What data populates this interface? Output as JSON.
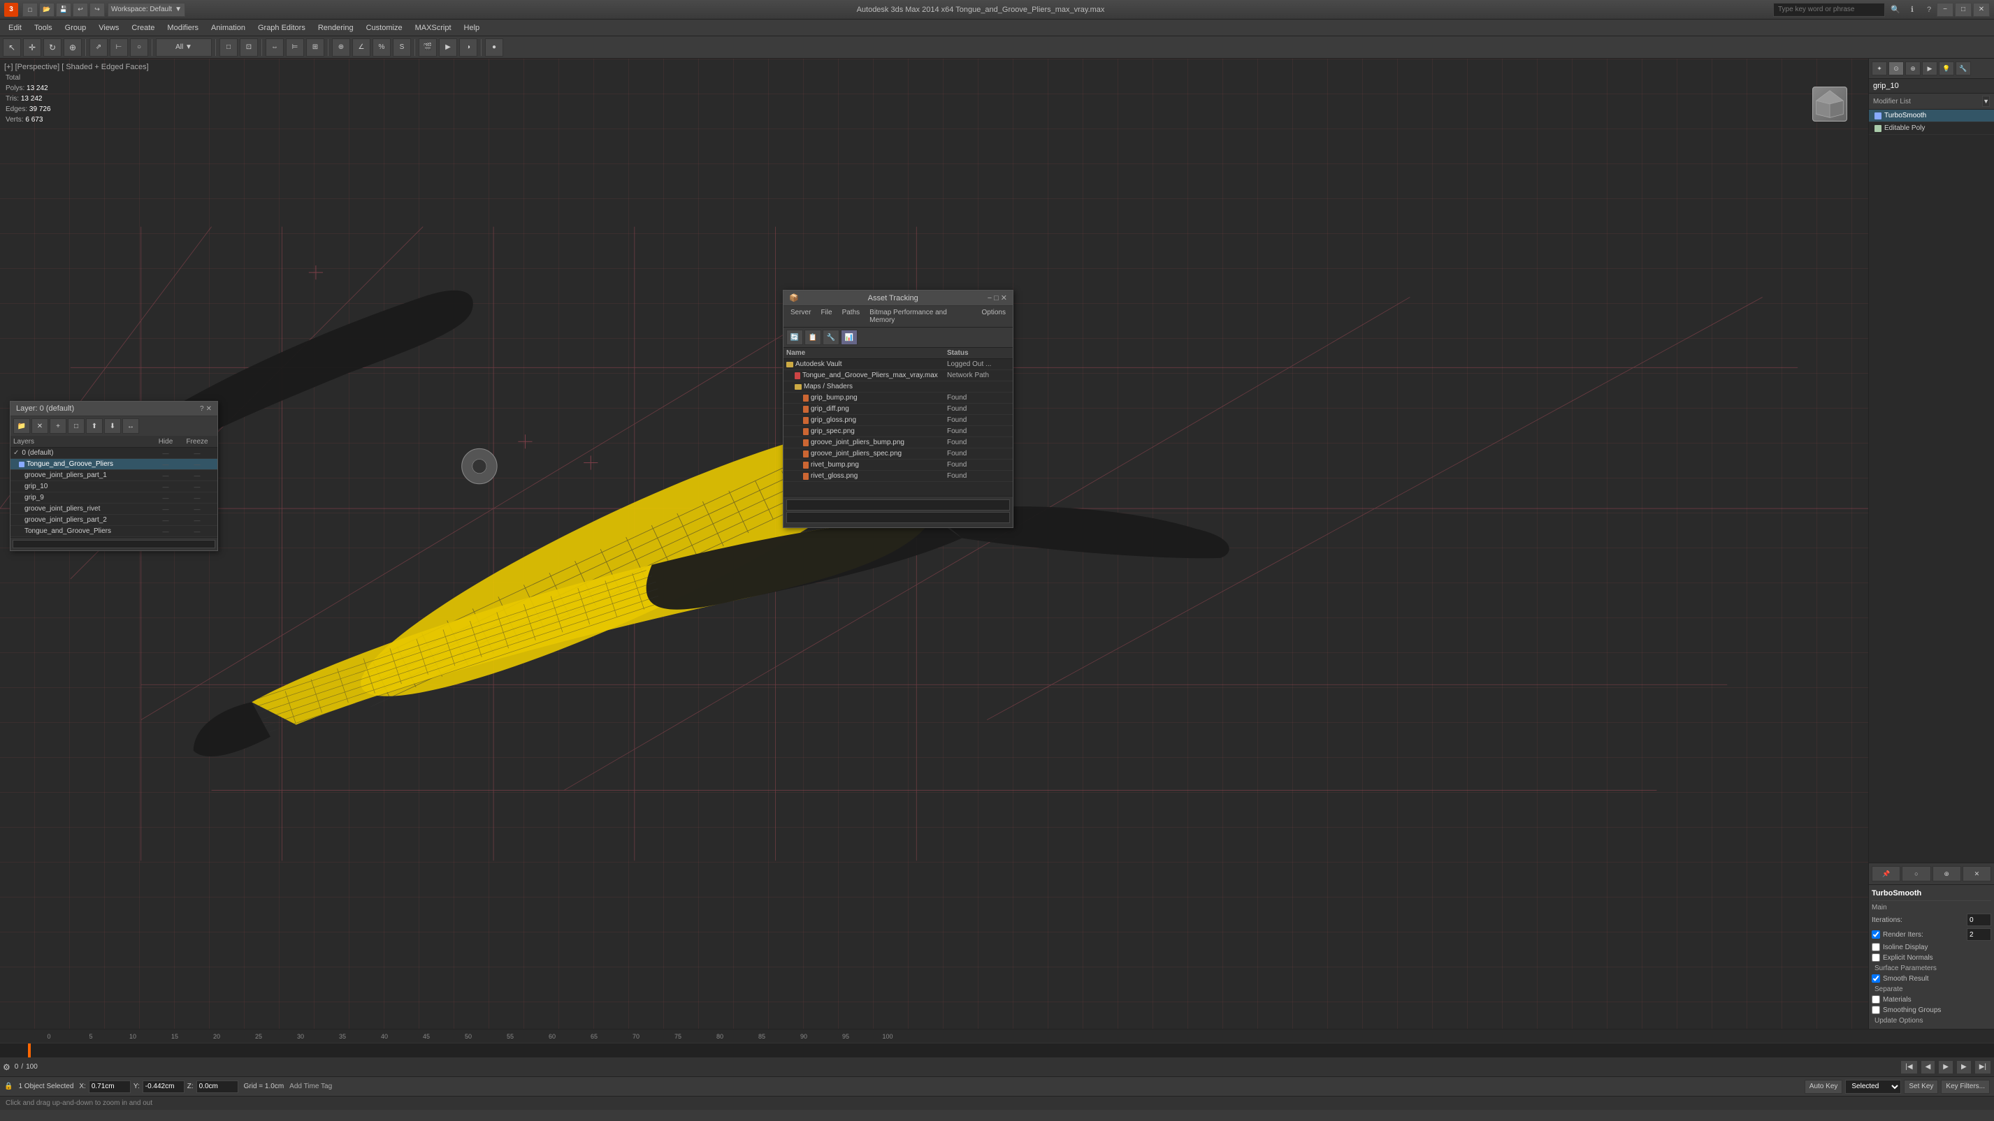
{
  "titlebar": {
    "app_icon": "3",
    "workspace_label": "Workspace: Default",
    "title": "Autodesk 3ds Max  2014 x64     Tongue_and_Groove_Pliers_max_vray.max",
    "search_placeholder": "Type key word or phrase",
    "min_label": "−",
    "max_label": "□",
    "close_label": "✕"
  },
  "menubar": {
    "items": [
      "Edit",
      "Tools",
      "Group",
      "Views",
      "Create",
      "Modifiers",
      "Animation",
      "Graph Editors",
      "Rendering",
      "Customize",
      "MAXScript",
      "Help"
    ]
  },
  "viewport": {
    "label": "[+] [Perspective] [ Shaded + Edged Faces]",
    "stats": {
      "total_label": "Total",
      "polys_label": "Polys:",
      "polys_value": "13 242",
      "tris_label": "Tris:",
      "tris_value": "13 242",
      "edges_label": "Edges:",
      "edges_value": "39 726",
      "verts_label": "Verts:",
      "verts_value": "6 673"
    }
  },
  "right_panel": {
    "object_name": "grip_10",
    "modifier_list_label": "Modifier List",
    "modifiers": [
      {
        "name": "TurboSmooth",
        "selected": true
      },
      {
        "name": "Editable Poly",
        "selected": false
      }
    ],
    "properties": {
      "title": "TurboSmooth",
      "main_label": "Main",
      "iterations_label": "Iterations:",
      "iterations_value": "0",
      "render_iters_label": "Render Iters:",
      "render_iters_value": "2",
      "isoline_display_label": "Isoline Display",
      "explicit_normals_label": "Explicit Normals",
      "surface_params_label": "Surface Parameters",
      "smooth_result_label": "Smooth Result",
      "smooth_result_checked": true,
      "separate_label": "Separate",
      "materials_label": "Materials",
      "smoothing_groups_label": "Smoothing Groups",
      "update_options_label": "Update Options"
    }
  },
  "layer_panel": {
    "title": "Layer: 0 (default)",
    "close_label": "✕",
    "toolbar_icons": [
      "📁",
      "✕",
      "+",
      "□",
      "⬆",
      "⬇",
      "↔"
    ],
    "header": {
      "layers_label": "Layers",
      "hide_label": "Hide",
      "freeze_label": "Freeze"
    },
    "layers": [
      {
        "name": "0 (default)",
        "indent": 0,
        "hide": "—",
        "freeze": "—",
        "has_check": true
      },
      {
        "name": "Tongue_and_Groove_Pliers",
        "indent": 1,
        "hide": "—",
        "freeze": "—",
        "selected": true
      },
      {
        "name": "groove_joint_pliers_part_1",
        "indent": 2,
        "hide": "—",
        "freeze": "—"
      },
      {
        "name": "grip_10",
        "indent": 2,
        "hide": "—",
        "freeze": "—"
      },
      {
        "name": "grip_9",
        "indent": 2,
        "hide": "—",
        "freeze": "—"
      },
      {
        "name": "groove_joint_pliers_rivet",
        "indent": 2,
        "hide": "—",
        "freeze": "—"
      },
      {
        "name": "groove_joint_pliers_part_2",
        "indent": 2,
        "hide": "—",
        "freeze": "—"
      },
      {
        "name": "Tongue_and_Groove_Pliers",
        "indent": 2,
        "hide": "—",
        "freeze": "—"
      }
    ]
  },
  "asset_panel": {
    "title": "Asset Tracking",
    "close_label": "✕",
    "min_label": "−",
    "max_label": "□",
    "menu_items": [
      "Server",
      "File",
      "Paths",
      "Bitmap Performance and Memory",
      "Options"
    ],
    "header": {
      "name_label": "Name",
      "status_label": "Status"
    },
    "assets": [
      {
        "name": "Autodesk Vault",
        "status": "Logged Out ...",
        "indent": 0,
        "type": "folder"
      },
      {
        "name": "Tongue_and_Groove_Pliers_max_vray.max",
        "status": "Network Path",
        "indent": 1,
        "type": "file"
      },
      {
        "name": "Maps / Shaders",
        "status": "",
        "indent": 1,
        "type": "folder"
      },
      {
        "name": "grip_bump.png",
        "status": "Found",
        "indent": 2,
        "type": "image"
      },
      {
        "name": "grip_diff.png",
        "status": "Found",
        "indent": 2,
        "type": "image"
      },
      {
        "name": "grip_gloss.png",
        "status": "Found",
        "indent": 2,
        "type": "image"
      },
      {
        "name": "grip_spec.png",
        "status": "Found",
        "indent": 2,
        "type": "image"
      },
      {
        "name": "groove_joint_pliers_bump.png",
        "status": "Found",
        "indent": 2,
        "type": "image"
      },
      {
        "name": "groove_joint_pliers_spec.png",
        "status": "Found",
        "indent": 2,
        "type": "image"
      },
      {
        "name": "rivet_bump.png",
        "status": "Found",
        "indent": 2,
        "type": "image"
      },
      {
        "name": "rivet_gloss.png",
        "status": "Found",
        "indent": 2,
        "type": "image"
      }
    ]
  },
  "timeline": {
    "frame_value": "0",
    "total_frames": "100",
    "ticks": [
      "0",
      "5",
      "10",
      "15",
      "20",
      "25",
      "30",
      "35",
      "40",
      "45",
      "50",
      "55",
      "60",
      "65",
      "70",
      "75",
      "80",
      "85",
      "90",
      "95",
      "100"
    ]
  },
  "status_bar": {
    "objects_selected": "1 Object Selected",
    "hint": "Click and drag up-and-down to zoom in and out",
    "x_label": "X:",
    "x_value": "0.71cm",
    "y_label": "Y:",
    "y_value": "-0.442cm",
    "z_label": "Z:",
    "z_value": "0.0cm",
    "grid_label": "Grid = 1.0cm",
    "auto_key_label": "Auto Key",
    "selected_label": "Selected",
    "set_key_label": "Set Key",
    "key_filters_label": "Key Filters..."
  },
  "playback": {
    "add_time_tag_label": "Add Time Tag"
  }
}
